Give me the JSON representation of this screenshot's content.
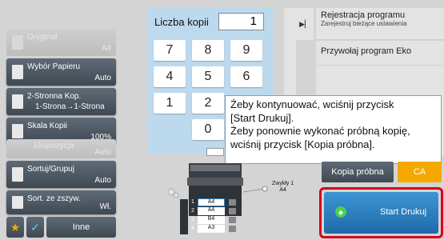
{
  "left_panel": {
    "original": {
      "label": "Oryginał",
      "value": "A4"
    },
    "paper": {
      "label": "Wybór Papieru",
      "value": "Auto"
    },
    "duplex": {
      "label": "2-Stronna Kop.",
      "value": "1-Strona→1-Strona"
    },
    "scale": {
      "label": "Skala Kopii",
      "value": "100%"
    },
    "exposure": {
      "label": "Ekspozycja",
      "value": "Auto"
    },
    "sort": {
      "label": "Sortuj/Grupuj",
      "value": "Auto"
    },
    "staple": {
      "label": "Sort. ze zszyw.",
      "value": "Wł."
    },
    "other_label": "Inne"
  },
  "keypad": {
    "title": "Liczba kopii",
    "value": "1",
    "keys": [
      "7",
      "8",
      "9",
      "4",
      "5",
      "6",
      "1",
      "2",
      "0"
    ]
  },
  "right_panel": {
    "register_title": "Rejestracja programu",
    "register_sub": "Zarejestruj bieżące ustawienia",
    "recall": "Przywołaj program Eko"
  },
  "tooltip": {
    "line1": "Żeby kontynuować, wciśnij przycisk",
    "line2": "[Start Drukuj].",
    "line3": "Żeby ponownie wykonać próbną kopię,",
    "line4": "wciśnij przycisk [Kopia próbna]."
  },
  "machine": {
    "output_label_1": "Zwykły 1",
    "output_label_2": "A4",
    "trays": [
      {
        "num": "1",
        "size": "A4"
      },
      {
        "num": "2",
        "size": "A4"
      },
      {
        "num": "3",
        "size": "B4"
      },
      {
        "num": "4",
        "size": "A3"
      }
    ]
  },
  "actions": {
    "proof": "Kopia próbna",
    "ca": "CA",
    "start": "Start Drukuj"
  },
  "colors": {
    "ca": "#f5a800",
    "start": "#2a7fc0",
    "highlight": "#d8001c"
  }
}
